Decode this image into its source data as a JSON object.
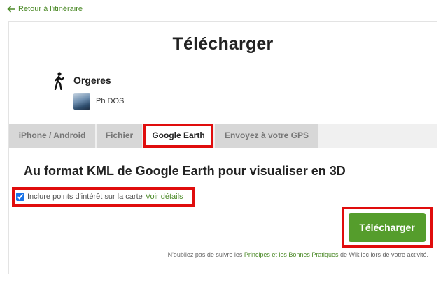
{
  "back_link": {
    "label": "Retour à l'itinéraire",
    "icon": "arrow-left-icon"
  },
  "title": "Télécharger",
  "track": {
    "icon": "hiking-icon",
    "name": "Orgeres"
  },
  "author": {
    "name": "Ph DOS"
  },
  "tabs": [
    {
      "label": "iPhone / Android",
      "active": false
    },
    {
      "label": "Fichier",
      "active": false
    },
    {
      "label": "Google Earth",
      "active": true
    },
    {
      "label": "Envoyez à votre GPS",
      "active": false
    }
  ],
  "format_title": "Au format KML de Google Earth pour visualiser en 3D",
  "poi_option": {
    "label": "Inclure points d'intérêt sur la carte",
    "link": "Voir détails",
    "checked": true
  },
  "download_button": "Télécharger",
  "note": {
    "prefix": "N'oubliez pas de suivre les ",
    "link": "Principes et les Bonnes Pratiques",
    "suffix": " de Wikiloc lors de votre activité."
  },
  "colors": {
    "accent": "#559d2c",
    "link": "#4c8a28",
    "highlight": "#e00d0d"
  }
}
